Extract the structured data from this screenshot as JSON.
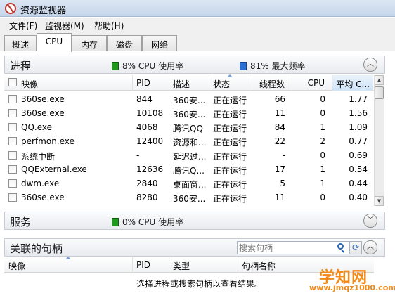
{
  "window": {
    "title": "资源监视器"
  },
  "menu": [
    "文件(F)",
    "监视器(M)",
    "帮助(H)"
  ],
  "tabs": [
    "概述",
    "CPU",
    "内存",
    "磁盘",
    "网络"
  ],
  "active_tab": "CPU",
  "processes": {
    "title": "进程",
    "cpu_usage": "8% CPU 使用率",
    "max_freq": "81% 最大频率",
    "columns": [
      "映像",
      "PID",
      "描述",
      "状态",
      "线程数",
      "CPU",
      "平均 C..."
    ],
    "rows": [
      [
        "360se.exe",
        "844",
        "360安...",
        "正在运行",
        "66",
        "0",
        "1.77"
      ],
      [
        "360se.exe",
        "10108",
        "360安...",
        "正在运行",
        "11",
        "0",
        "1.56"
      ],
      [
        "QQ.exe",
        "4068",
        "腾讯QQ",
        "正在运行",
        "84",
        "1",
        "1.09"
      ],
      [
        "perfmon.exe",
        "12400",
        "资源和...",
        "正在运行",
        "22",
        "2",
        "0.77"
      ],
      [
        "系统中断",
        "-",
        "延迟过...",
        "正在运行",
        "-",
        "0",
        "0.69"
      ],
      [
        "QQExternal.exe",
        "12636",
        "腾讯Q...",
        "正在运行",
        "17",
        "1",
        "0.54"
      ],
      [
        "dwm.exe",
        "2840",
        "桌面窗...",
        "正在运行",
        "5",
        "1",
        "0.44"
      ],
      [
        "360se.exe",
        "8280",
        "360安...",
        "正在运行",
        "11",
        "0",
        "0.40"
      ]
    ]
  },
  "services": {
    "title": "服务",
    "cpu_usage": "0% CPU 使用率"
  },
  "handles": {
    "title": "关联的句柄",
    "search_placeholder": "搜索句柄",
    "columns": [
      "映像",
      "PID",
      "类型",
      "句柄名称"
    ],
    "empty_message": "选择进程或搜索句柄以查看结果。"
  },
  "watermark": {
    "main": "学知网",
    "sub": "www.jmqz1000.com"
  },
  "colors": {
    "cpu_indicator": "#1f9a1f",
    "freq_indicator": "#2a6fd6",
    "sorted_column": "#cfe3f8",
    "watermark": "#f08a1a"
  },
  "icons": {
    "app": "resource-monitor-icon",
    "collapse": "chevron-up-icon",
    "expand": "chevron-down-icon",
    "search": "search-icon",
    "refresh": "refresh-icon"
  }
}
